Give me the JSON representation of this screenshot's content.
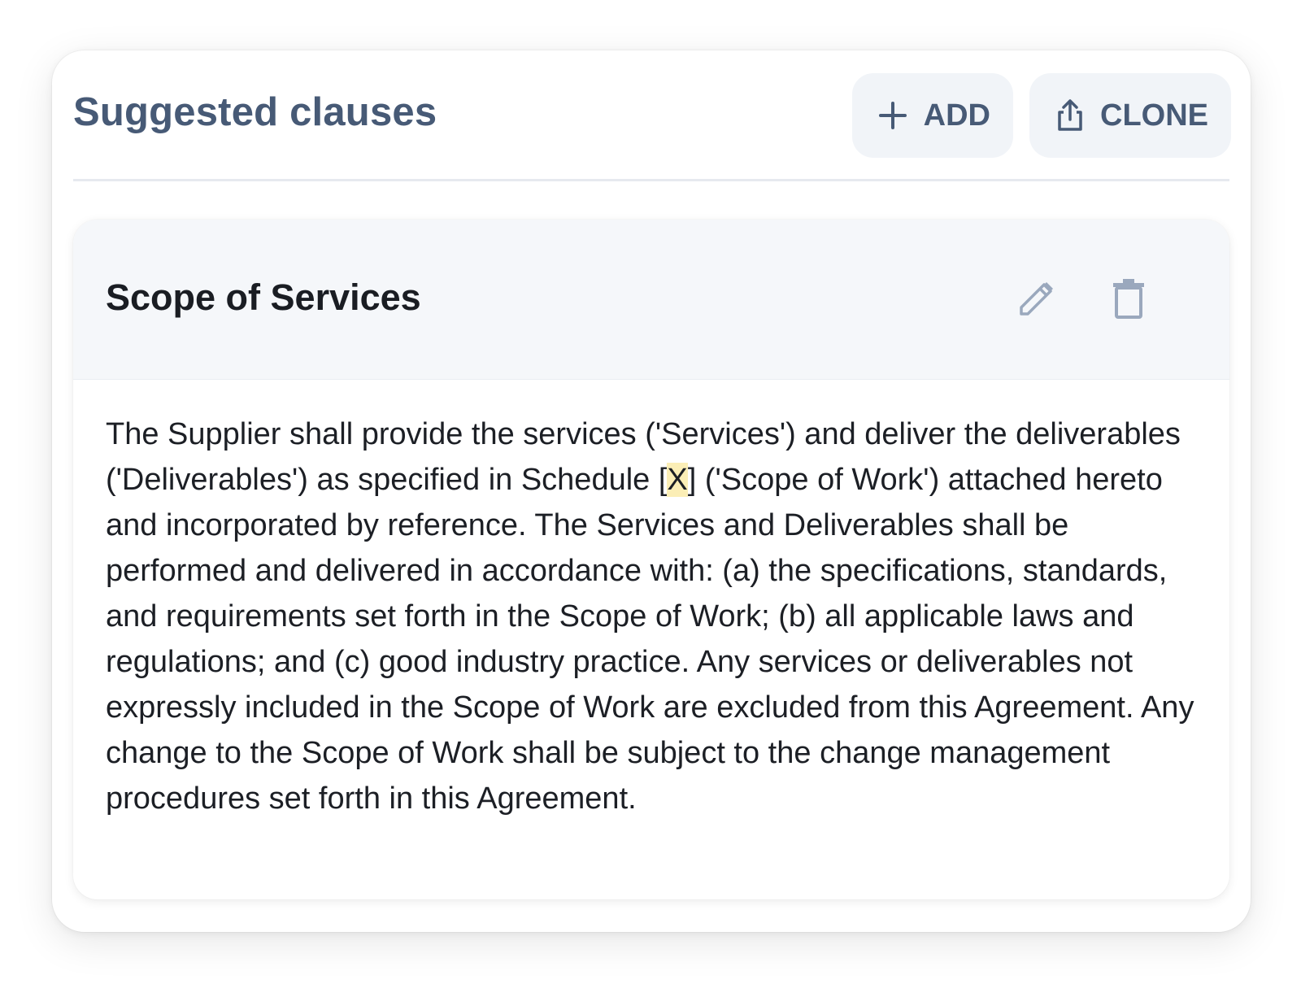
{
  "panel": {
    "title": "Suggested clauses",
    "add_button": {
      "label": "ADD",
      "icon": "plus-icon"
    },
    "clone_button": {
      "label": "CLONE",
      "icon": "share-icon"
    }
  },
  "clause": {
    "title": "Scope of Services",
    "edit_icon": "pencil-icon",
    "delete_icon": "trash-icon",
    "body_before": "The Supplier shall provide the services ('Services') and deliver the deliverables ('Deliverables') as specified in Schedule [",
    "body_placeholder": "X",
    "body_after": "] ('Scope of Work') attached hereto and incorporated by reference. The Services and Deliverables shall be performed and delivered in accordance with: (a) the specifications, standards, and requirements set forth in the Scope of Work; (b) all applicable laws and regulations; and (c) good industry practice. Any services or deliverables not expressly included in the Scope of Work are excluded from this Agreement. Any change to the Scope of Work shall be subject to the change management procedures set forth in this Agreement."
  },
  "colors": {
    "title_text": "#475a76",
    "button_bg": "#f1f4f8",
    "card_header_bg": "#f5f7fa",
    "icon_muted": "#9aa8bd",
    "placeholder_highlight": "#fbeeb6"
  }
}
